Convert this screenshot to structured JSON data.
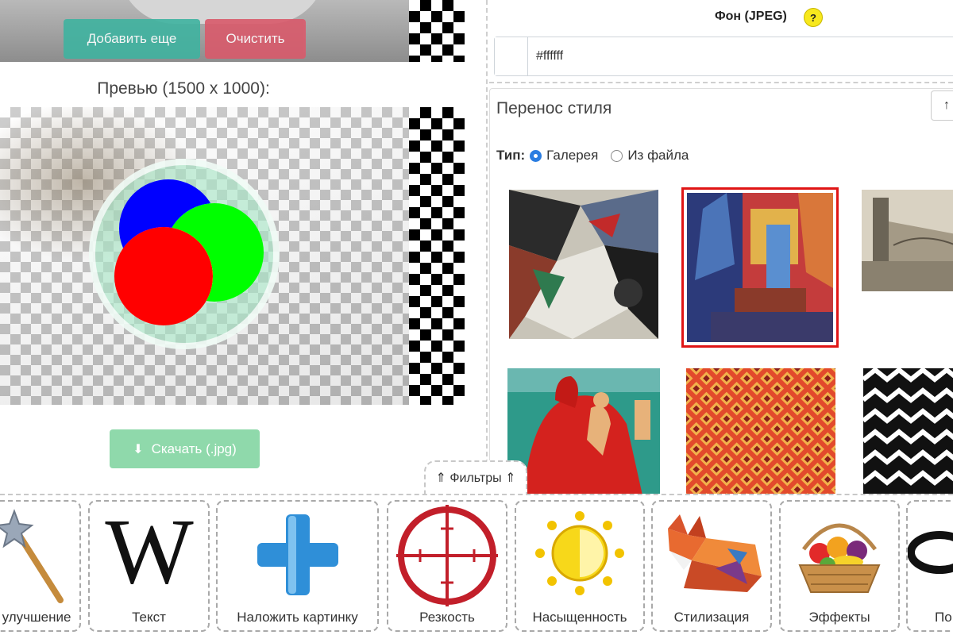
{
  "toolbar": {
    "add_more": "Добавить еще",
    "clear": "Очистить"
  },
  "preview": {
    "title": "Превью (1500 x 1000):",
    "download": "Скачать (.jpg)"
  },
  "background": {
    "label": "Фон (JPEG)",
    "help": "?",
    "value": "#ffffff"
  },
  "style_transfer": {
    "title": "Перенос стиля",
    "type_label": "Тип:",
    "options": [
      "Галерея",
      "Из файла"
    ],
    "selected_option": "Галерея",
    "collapse_icon": "arrow-up-icon",
    "selected_thumbnail_index": 1
  },
  "filters": {
    "tab_label": "⇑ Фильтры ⇑",
    "tools": [
      "улучшение",
      "Текст",
      "Наложить картинку",
      "Резкость",
      "Насыщенность",
      "Стилизация",
      "Эффекты",
      "По"
    ]
  },
  "icons": {
    "download": "download-icon",
    "tools": [
      "magic-wand-icon",
      "letter-w-icon",
      "plus-icon",
      "crosshair-icon",
      "sun-contrast-icon",
      "lowpoly-fox-icon",
      "fruit-basket-icon",
      "ring-icon"
    ]
  },
  "colors": {
    "add_more": "#3fb3a0",
    "clear": "#d95a6b",
    "download": "#8fd9ab",
    "help_badge": "#f7e81d",
    "selected_border": "#e01515",
    "radio_on": "#2a7de1"
  }
}
